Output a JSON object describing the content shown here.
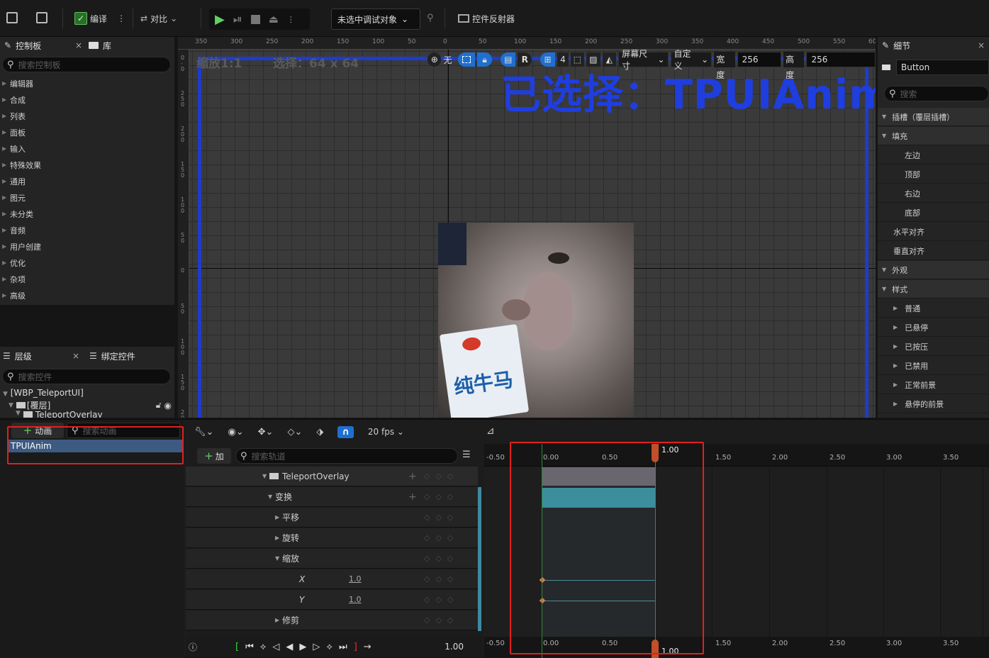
{
  "toolbar": {
    "compile_label": "编译",
    "diff_label": "对比",
    "debug_target": "未选中调试对象",
    "reflector_label": "控件反射器"
  },
  "palette": {
    "tab_label": "控制板",
    "library_tab_label": "库",
    "search_placeholder": "搜索控制板",
    "categories": [
      "编辑器",
      "合成",
      "列表",
      "面板",
      "输入",
      "特殊效果",
      "通用",
      "图元",
      "未分类",
      "音频",
      "用户创建",
      "优化",
      "杂项",
      "高级"
    ]
  },
  "hierarchy": {
    "tab_label": "层级",
    "bindings_tab_label": "绑定控件",
    "search_placeholder": "搜索控件",
    "root": "[WBP_TeleportUI]",
    "overlay_item": "[覆层]",
    "child_item": "TeleportOverlay"
  },
  "viewport": {
    "zoom_label": "缩放1:1",
    "selection_size": "选择：64 x 64",
    "selected_title": "已选择：TPUIAnim",
    "none_label": "无",
    "r_label": "R",
    "grid_count": "4",
    "screen_size_label": "屏幕尺寸",
    "custom_label": "自定义",
    "width_label": "宽度",
    "width_value": "256",
    "height_label": "高度",
    "height_value": "256",
    "ruler_ticks": [
      "350",
      "300",
      "250",
      "200",
      "150",
      "100",
      "50",
      "0",
      "50",
      "100",
      "150",
      "200",
      "250",
      "300",
      "350",
      "400",
      "450",
      "500",
      "550",
      "60"
    ]
  },
  "details": {
    "tab_label": "细节",
    "widget_name": "Button",
    "search_placeholder": "搜索",
    "slot_section": "插槽（覆层插槽）",
    "padding_section": "填充",
    "padding_items": [
      "左边",
      "顶部",
      "右边",
      "底部"
    ],
    "h_align": "水平对齐",
    "v_align": "垂直对齐",
    "appearance_section": "外观",
    "style_section": "样式",
    "style_items": [
      "普通",
      "已悬停",
      "已按压",
      "已禁用",
      "正常前景",
      "悬停的前景"
    ]
  },
  "animations": {
    "add_label": "动画",
    "search_placeholder": "搜索动画",
    "items": [
      "TPUIAnim"
    ]
  },
  "sequencer": {
    "fps_label": "20 fps",
    "add_track_label": "加",
    "track_search_placeholder": "搜索轨道",
    "tracks": [
      {
        "label": "TeleportOverlay",
        "value": ""
      },
      {
        "label": "变换",
        "value": ""
      },
      {
        "label": "平移",
        "value": ""
      },
      {
        "label": "旋转",
        "value": ""
      },
      {
        "label": "缩放",
        "value": ""
      },
      {
        "label": "X",
        "value": "1.0"
      },
      {
        "label": "Y",
        "value": "1.0"
      },
      {
        "label": "修剪",
        "value": ""
      }
    ],
    "current_time": "1.00",
    "playhead_label": "1.00",
    "timeline_ticks": [
      "-0.50",
      "0.00",
      "0.50",
      "1.50",
      "2.00",
      "2.50",
      "3.00",
      "3.50"
    ]
  }
}
